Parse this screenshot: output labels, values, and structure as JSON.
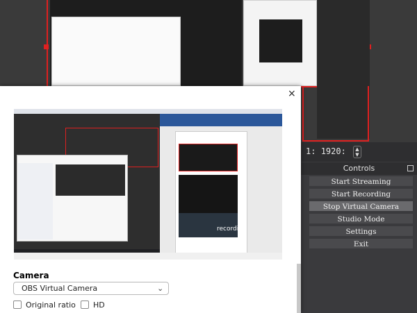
{
  "obs": {
    "resolution_prefix": "1:",
    "resolution_value": "1920:",
    "controls_title": "Controls",
    "buttons": [
      {
        "label": "Start Streaming",
        "active": false
      },
      {
        "label": "Start Recording",
        "active": false
      },
      {
        "label": "Stop Virtual Camera",
        "active": true
      },
      {
        "label": "Studio Mode",
        "active": false
      },
      {
        "label": "Settings",
        "active": false
      },
      {
        "label": "Exit",
        "active": false
      }
    ],
    "preview_word": "recording"
  },
  "dialog": {
    "close_glyph": "×",
    "camera_label": "Camera",
    "camera_selected": "OBS Virtual Camera",
    "options": [
      {
        "label": "Original ratio",
        "checked": false
      },
      {
        "label": "HD",
        "checked": false
      }
    ]
  },
  "colors": {
    "accent_red": "#e02020",
    "obs_bg": "#3a3a3d",
    "button_bg": "#4a4a4d",
    "button_active_bg": "#6a6a6d"
  },
  "icons": {
    "close": "close-icon",
    "dropdown": "chevron-down-icon",
    "stepper": "stepper-icon",
    "pin": "dock-float-icon"
  }
}
